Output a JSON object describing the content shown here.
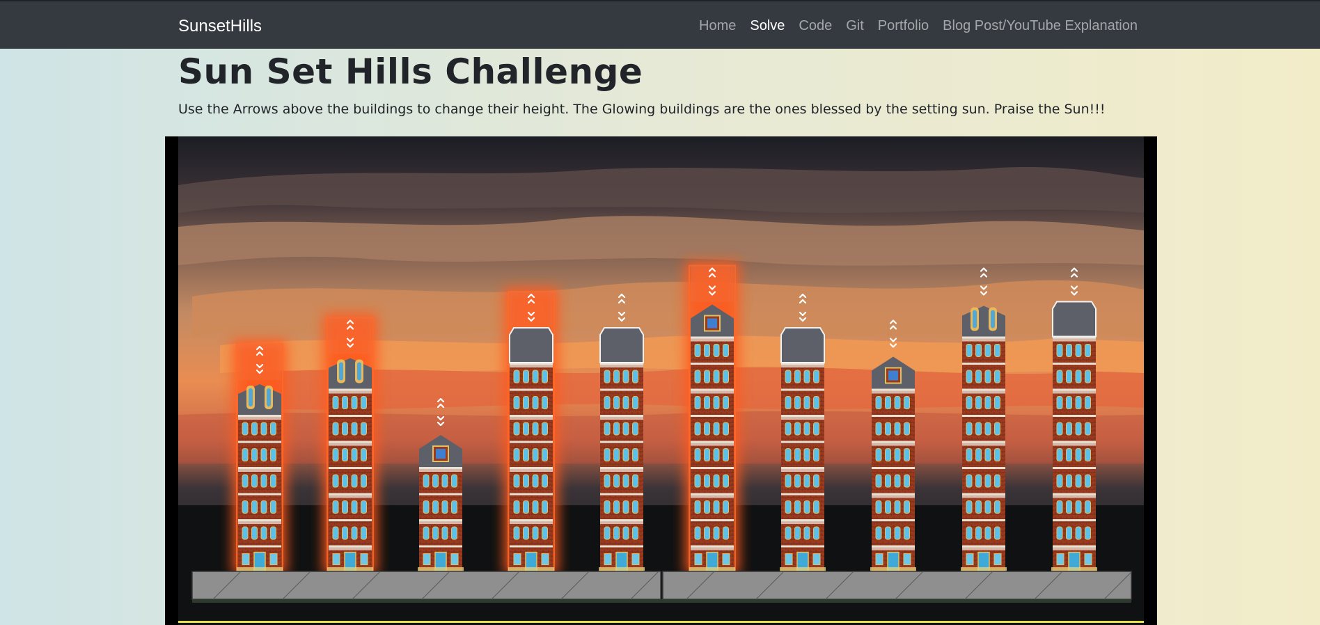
{
  "nav": {
    "brand": "SunsetHills",
    "links": [
      {
        "label": "Home",
        "active": false
      },
      {
        "label": "Solve",
        "active": true
      },
      {
        "label": "Code",
        "active": false
      },
      {
        "label": "Git",
        "active": false
      },
      {
        "label": "Portfolio",
        "active": false
      },
      {
        "label": "Blog Post/YouTube Explanation",
        "active": false
      }
    ]
  },
  "page": {
    "title": "Sun Set Hills Challenge",
    "instructions": "Use the Arrows above the buildings to change their height. The Glowing buildings are the ones blessed by the setting sun. Praise the Sun!!!"
  },
  "buildings": [
    {
      "floors": 6,
      "roof": "twin-dormer",
      "glowing": true
    },
    {
      "floors": 7,
      "roof": "twin-dormer",
      "glowing": true
    },
    {
      "floors": 4,
      "roof": "gable-window",
      "glowing": false
    },
    {
      "floors": 8,
      "roof": "slate",
      "glowing": true
    },
    {
      "floors": 8,
      "roof": "slate",
      "glowing": false
    },
    {
      "floors": 9,
      "roof": "gable-window",
      "glowing": true
    },
    {
      "floors": 8,
      "roof": "slate",
      "glowing": false
    },
    {
      "floors": 7,
      "roof": "gable-window",
      "glowing": false
    },
    {
      "floors": 9,
      "roof": "twin-dormer",
      "glowing": false
    },
    {
      "floors": 9,
      "roof": "slate",
      "glowing": false
    }
  ],
  "colors": {
    "navbar": "#343a40",
    "glow": "#ff5a1f",
    "brick": "#9c3b22",
    "roof": "#5d6068",
    "sidewalk": "#8c8c8c",
    "ground_line": "#e8e04a"
  },
  "icons": {
    "raise": "chevron-up-icon",
    "lower": "chevron-down-icon"
  }
}
